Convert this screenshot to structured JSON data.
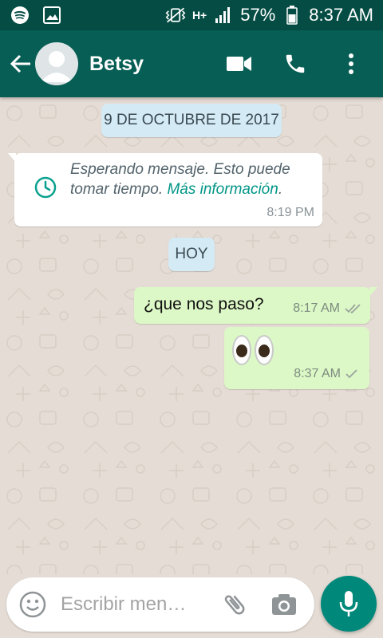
{
  "status_bar": {
    "battery_percent": "57%",
    "time": "8:37 AM",
    "network_type": "H+",
    "icons": [
      "spotify-icon",
      "gallery-icon",
      "vibrate-icon",
      "signal-icon",
      "battery-icon"
    ]
  },
  "app_bar": {
    "contact_name": "Betsy",
    "icons": [
      "back-arrow-icon",
      "avatar-icon",
      "video-call-icon",
      "phone-icon",
      "more-options-icon"
    ]
  },
  "chat": {
    "date_label": "9 DE OCTUBRE DE 2017",
    "system_message": {
      "text": "Esperando mensaje. Esto puede tomar tiempo. ",
      "link": "Más información",
      "trailing": ".",
      "time": "8:19 PM",
      "icon": "clock-icon"
    },
    "today_label": "HOY",
    "messages": [
      {
        "text": "¿que nos paso?",
        "time": "8:17 AM",
        "status": "delivered-double-check"
      },
      {
        "text": "👀",
        "time": "8:37 AM",
        "status": "sent-single-check"
      }
    ]
  },
  "input": {
    "placeholder": "Escribir men…",
    "icons": [
      "emoji-icon",
      "attach-icon",
      "camera-icon",
      "mic-icon"
    ]
  },
  "colors": {
    "status_bar": "#054d44",
    "app_bar": "#075e54",
    "chat_background": "#e5ddd5",
    "outgoing_bubble": "#dcf8c6",
    "date_pill": "#d4eaf4",
    "accent": "#00897b",
    "link": "#019587"
  }
}
